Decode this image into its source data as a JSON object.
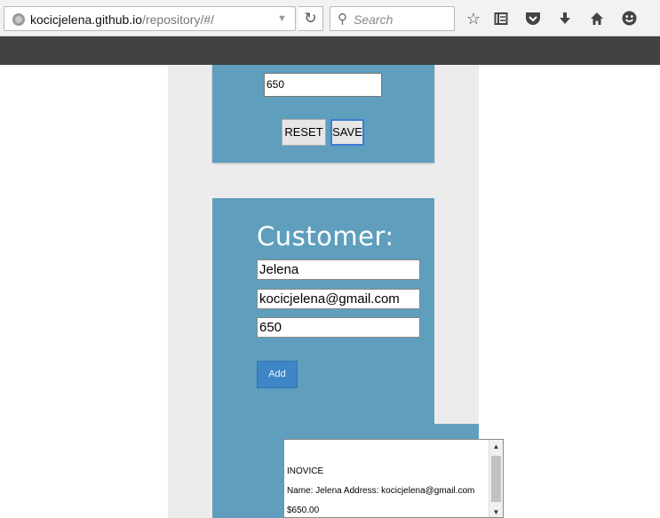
{
  "browser": {
    "url_host": "kocicjelena.github.io",
    "url_path": "/repository/#/",
    "search_placeholder": "Search",
    "icons": [
      "globe-icon",
      "reload-icon",
      "search-icon",
      "bookmark-star-icon",
      "reading-list-icon",
      "pocket-icon",
      "download-icon",
      "home-icon",
      "smiley-icon"
    ]
  },
  "top_panel": {
    "amount_value": "650",
    "reset_label": "RESET",
    "save_label": "SAVE"
  },
  "customer": {
    "title": "Customer:",
    "name_value": "Jelena",
    "email_value": "kocicjelena@gmail.com",
    "amount_value": "650",
    "add_label": "Add"
  },
  "invoice": {
    "title": "INOVICE",
    "name_line": "Name: Jelena Address: kocicjelena@gmail.com",
    "amount_line": "$650.00"
  },
  "colors": {
    "panel": "#5f9fbd",
    "page_column": "#ececec",
    "dark_bar": "#424242",
    "add_button": "#3f86c8"
  }
}
